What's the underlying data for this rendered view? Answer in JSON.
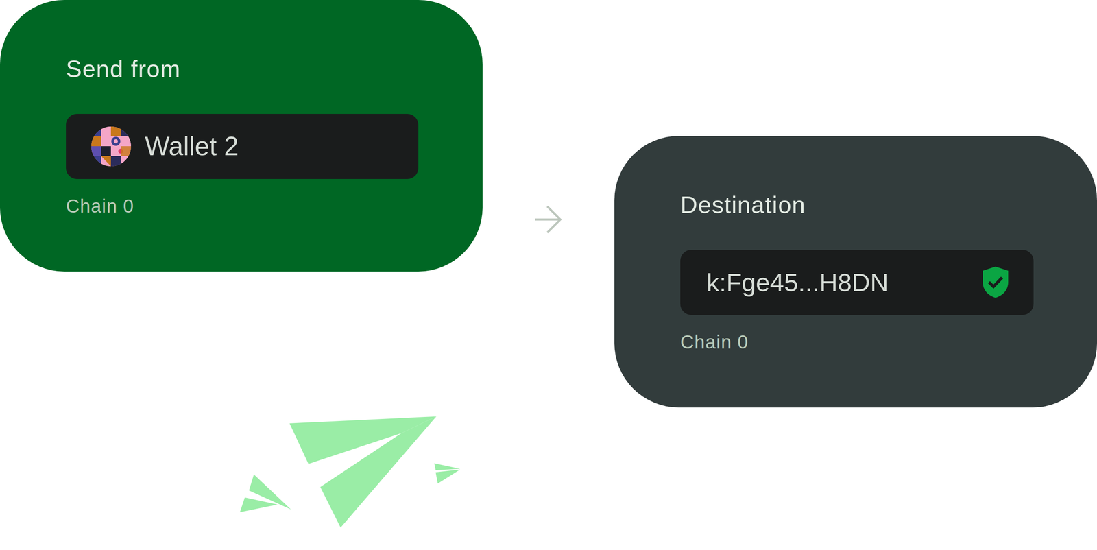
{
  "source": {
    "title": "Send from",
    "wallet": "Wallet 2",
    "chain": "Chain 0"
  },
  "destination": {
    "title": "Destination",
    "account": "k:Fge45...H8DN",
    "verified": true,
    "chain": "Chain 0"
  }
}
